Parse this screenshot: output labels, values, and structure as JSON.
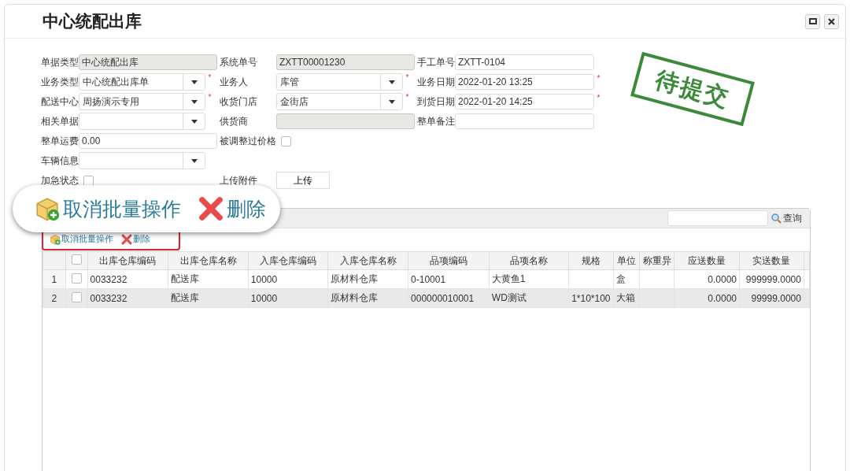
{
  "title": "中心统配出库",
  "stamp": "待提交",
  "form": {
    "rows": [
      [
        {
          "label": "单据类型",
          "kind": "readonly",
          "value": "中心统配出库"
        },
        {
          "label": "系统单号",
          "kind": "readonly",
          "value": "ZXTT00001230"
        },
        {
          "label": "手工单号",
          "kind": "text",
          "value": "ZXTT-0104"
        }
      ],
      [
        {
          "label": "业务类型",
          "kind": "select",
          "value": "中心统配出库单",
          "required_mark": "*"
        },
        {
          "label": "业务人",
          "kind": "select",
          "value": "库管",
          "required_mark": "*"
        },
        {
          "label": "业务日期",
          "kind": "text",
          "value": "2022-01-20 13:25",
          "required_mark": "*"
        }
      ],
      [
        {
          "label": "配送中心",
          "kind": "select",
          "value": "周扬演示专用",
          "required_mark": "*"
        },
        {
          "label": "收货门店",
          "kind": "select",
          "value": "金街店",
          "required_mark": "*"
        },
        {
          "label": "到货日期",
          "kind": "text",
          "value": "2022-01-20 14:25",
          "required_mark": "*"
        }
      ],
      [
        {
          "label": "相关单据",
          "kind": "select"
        },
        {
          "label": "供货商",
          "kind": "readonly"
        },
        {
          "label": "整单备注",
          "kind": "text"
        }
      ],
      [
        {
          "label": "整单运费",
          "kind": "wide",
          "value": "0.00"
        },
        {
          "label": "被调整过价格",
          "kind": "checkbox",
          "checked": false
        }
      ],
      [
        {
          "label": "车辆信息",
          "kind": "select"
        }
      ],
      [
        {
          "label": "加急状态",
          "kind": "checkbox",
          "checked": false
        },
        {
          "label": "上传附件",
          "kind": "upload",
          "value": "上传"
        }
      ]
    ]
  },
  "callout": {
    "buttons": [
      {
        "label": "取消批量操作",
        "kind": "batch"
      },
      {
        "label": "删除",
        "kind": "delete"
      }
    ]
  },
  "grid": {
    "search_button": "查询",
    "toolbar": [
      {
        "label": "取消批量操作",
        "kind": "batch"
      },
      {
        "label": "删除",
        "kind": "delete"
      }
    ],
    "header_checkbox": {
      "checked": false
    },
    "columns": [
      "出库仓库编码",
      "出库仓库名称",
      "入库仓库编码",
      "入库仓库名称",
      "品项编码",
      "品项名称",
      "规格",
      "单位",
      "称重异",
      "应送数量",
      "实送数量"
    ],
    "rows": [
      {
        "number": "1",
        "checked": false,
        "cells": [
          "0033232",
          "配送库",
          "10000",
          "原材料仓库",
          "0-10001",
          "大黄鱼1",
          "",
          "盒",
          "",
          "0.0000",
          "999999.0000"
        ]
      },
      {
        "number": "2",
        "checked": false,
        "cells": [
          "0033232",
          "配送库",
          "10000",
          "原材料仓库",
          "000000010001",
          "WD测试",
          "1*10*100",
          "大箱",
          "",
          "0.0000",
          "99999.0000"
        ]
      }
    ]
  }
}
